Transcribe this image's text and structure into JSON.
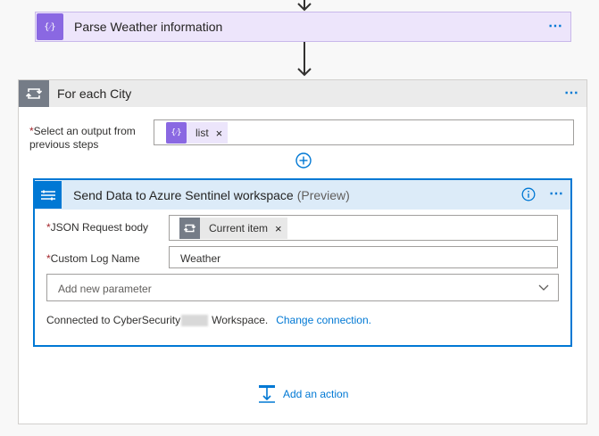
{
  "parse_step": {
    "title": "Parse Weather information",
    "icon": "braces-icon",
    "more_label": "⋯"
  },
  "foreach": {
    "title": "For each City",
    "icon": "loop-icon",
    "more_label": "⋯",
    "output_label": "Select an output from previous steps",
    "output_label_line1": "Select an output from",
    "output_label_line2": "previous steps",
    "required_mark": "*",
    "output_token": "list",
    "token_remove": "×"
  },
  "sentinel": {
    "title": "Send Data to Azure Sentinel workspace",
    "preview": "(Preview)",
    "info_icon": "info-icon",
    "more_label": "⋯",
    "json_label": "JSON Request body",
    "json_token": "Current item",
    "log_label": "Custom Log Name",
    "log_value": "Weather",
    "add_param_placeholder": "Add new parameter",
    "connected_prefix": "Connected to CyberSecurity",
    "connected_suffix": "Workspace.",
    "change_connection": "Change connection."
  },
  "add_action": {
    "label": "Add an action"
  },
  "colors": {
    "accent": "#0078d4",
    "purple": "#8a68e2",
    "loop_gray": "#757c87",
    "required": "#a4262c"
  }
}
